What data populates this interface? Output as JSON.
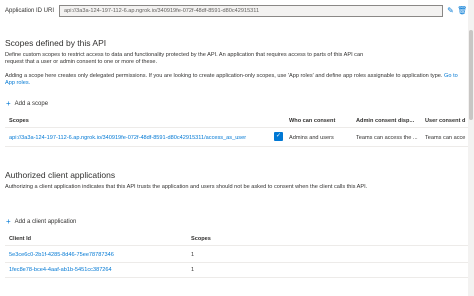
{
  "app_id_uri": {
    "label": "Application ID URI",
    "value": "api://3a3a-124-197-112-6.ap.ngrok.io/340919fe-072f-48df-8591-d80c42915311"
  },
  "scopes_section": {
    "title": "Scopes defined by this API",
    "description": "Define custom scopes to restrict access to data and functionality protected by the API. An application that requires access to parts of this API can request that a user or admin consent to one or more of these.",
    "info_text": "Adding a scope here creates only delegated permissions. If you are looking to create application-only scopes, use 'App roles' and define app roles assignable to application type.",
    "info_link": "Go to App roles.",
    "add_button": "Add a scope",
    "columns": [
      "Scopes",
      "Who can consent",
      "Admin consent disp...",
      "User consent d"
    ],
    "rows": [
      {
        "scope": "api://3a3a-124-197-112-6.ap.ngrok.io/340919fe-072f-48df-8591-d80c42915311/access_as_user",
        "who": "Admins and users",
        "admin_display": "Teams can access the ...",
        "user_display": "Teams can acce"
      }
    ]
  },
  "authorized_section": {
    "title": "Authorized client applications",
    "description": "Authorizing a client application indicates that this API trusts the application and users should not be asked to consent when the client calls this API.",
    "add_button": "Add a client application",
    "columns": [
      "Client Id",
      "Scopes"
    ],
    "rows": [
      {
        "client_id": "5e3ce6c0-2b1f-4285-8d46-75ee78787346",
        "scopes": "1"
      },
      {
        "client_id": "1fec8e78-bce4-4aaf-ab1b-5451cc387264",
        "scopes": "1"
      }
    ]
  },
  "icons": {
    "edit": "edit-icon",
    "delete": "delete-icon",
    "add": "plus-icon",
    "consent": "consent-icon"
  },
  "colors": {
    "accent": "#0078d4",
    "text": "#323130",
    "border": "#edebe9"
  }
}
